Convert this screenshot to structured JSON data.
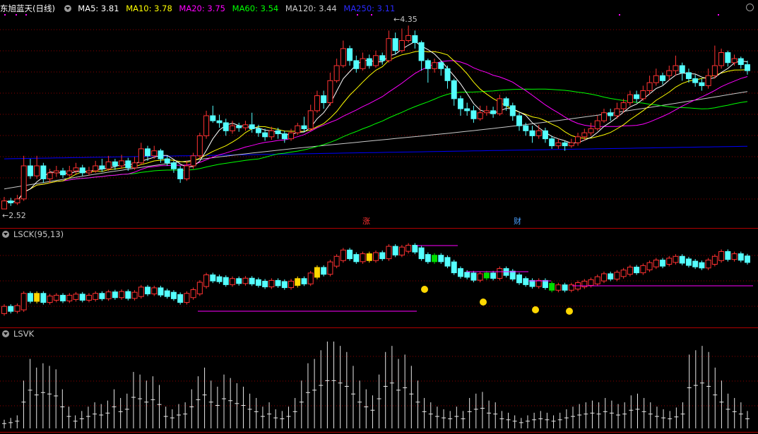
{
  "main_title": {
    "stock_name": "东旭蓝天",
    "period": "(日线)",
    "ma": [
      {
        "label": "MA5: 3.81",
        "color": "#ffffff"
      },
      {
        "label": "MA10: 3.78",
        "color": "#ffff00"
      },
      {
        "label": "MA20: 3.75",
        "color": "#ff00ff"
      },
      {
        "label": "MA60: 3.54",
        "color": "#00ff00"
      },
      {
        "label": "MA120: 3.44",
        "color": "#c8c8c8"
      },
      {
        "label": "MA250: 3.11",
        "color": "#0000ff"
      }
    ]
  },
  "annotations": {
    "high": "4.35",
    "low": "2.52",
    "event1": "涨",
    "event2": "财"
  },
  "sub1_title": "LSCK(95,13)",
  "sub2_title": "LSVK",
  "colors": {
    "up": "#ff3232",
    "down": "#54ffff",
    "ma5": "#ffffff",
    "ma10": "#ffff00",
    "ma20": "#ff00ff",
    "ma60": "#00ff00",
    "ma120": "#c8c8c8",
    "ma250": "#0000ff",
    "grid": "#8b0000",
    "border": "#b00000"
  },
  "chart_data": {
    "type": "candlestick",
    "price_range": [
      2.45,
      4.45
    ],
    "extremes": {
      "high": 4.35,
      "low": 2.52
    },
    "candles": [
      [
        2.52,
        2.6,
        2.64,
        2.52
      ],
      [
        2.6,
        2.58,
        2.63,
        2.55
      ],
      [
        2.58,
        2.62,
        2.66,
        2.56
      ],
      [
        2.62,
        2.95,
        3.05,
        2.6
      ],
      [
        2.95,
        2.85,
        3.02,
        2.82
      ],
      [
        2.85,
        2.95,
        3.05,
        2.82
      ],
      [
        2.95,
        2.82,
        2.98,
        2.78
      ],
      [
        2.82,
        2.88,
        2.92,
        2.78
      ],
      [
        2.88,
        2.9,
        2.95,
        2.84
      ],
      [
        2.9,
        2.86,
        2.93,
        2.83
      ],
      [
        2.86,
        2.9,
        2.95,
        2.84
      ],
      [
        2.9,
        2.93,
        2.98,
        2.87
      ],
      [
        2.93,
        2.88,
        2.96,
        2.85
      ],
      [
        2.88,
        2.9,
        2.94,
        2.85
      ],
      [
        2.9,
        2.95,
        3.0,
        2.88
      ],
      [
        2.95,
        2.92,
        3.02,
        2.89
      ],
      [
        2.92,
        2.99,
        3.05,
        2.9
      ],
      [
        2.99,
        2.95,
        3.02,
        2.91
      ],
      [
        2.95,
        3.0,
        3.06,
        2.92
      ],
      [
        3.0,
        2.93,
        3.03,
        2.9
      ],
      [
        2.93,
        2.98,
        3.04,
        2.91
      ],
      [
        2.98,
        3.12,
        3.18,
        2.96
      ],
      [
        3.12,
        3.05,
        3.15,
        3.0
      ],
      [
        3.05,
        3.1,
        3.15,
        3.02
      ],
      [
        3.1,
        3.02,
        3.12,
        2.98
      ],
      [
        3.02,
        2.98,
        3.05,
        2.95
      ],
      [
        2.98,
        2.92,
        3.0,
        2.88
      ],
      [
        2.92,
        2.82,
        2.95,
        2.78
      ],
      [
        2.82,
        2.95,
        3.0,
        2.8
      ],
      [
        2.95,
        3.05,
        3.08,
        2.92
      ],
      [
        3.05,
        3.25,
        3.28,
        3.02
      ],
      [
        3.25,
        3.45,
        3.5,
        3.22
      ],
      [
        3.45,
        3.4,
        3.55,
        3.38
      ],
      [
        3.4,
        3.38,
        3.46,
        3.33
      ],
      [
        3.38,
        3.3,
        3.42,
        3.25
      ],
      [
        3.3,
        3.35,
        3.4,
        3.27
      ],
      [
        3.35,
        3.33,
        3.38,
        3.29
      ],
      [
        3.33,
        3.36,
        3.4,
        3.3
      ],
      [
        3.36,
        3.32,
        3.48,
        3.28
      ],
      [
        3.32,
        3.28,
        3.36,
        3.24
      ],
      [
        3.28,
        3.24,
        3.32,
        3.2
      ],
      [
        3.24,
        3.3,
        3.34,
        3.21
      ],
      [
        3.3,
        3.27,
        3.33,
        3.22
      ],
      [
        3.27,
        3.22,
        3.3,
        3.18
      ],
      [
        3.22,
        3.28,
        3.32,
        3.2
      ],
      [
        3.28,
        3.35,
        3.38,
        3.26
      ],
      [
        3.35,
        3.32,
        3.44,
        3.29
      ],
      [
        3.32,
        3.5,
        3.56,
        3.3
      ],
      [
        3.5,
        3.65,
        3.7,
        3.48
      ],
      [
        3.65,
        3.58,
        3.7,
        3.52
      ],
      [
        3.58,
        3.8,
        3.88,
        3.55
      ],
      [
        3.8,
        3.95,
        4.02,
        3.78
      ],
      [
        3.95,
        4.12,
        4.2,
        3.93
      ],
      [
        4.12,
        4.0,
        4.15,
        3.95
      ],
      [
        4.0,
        3.92,
        4.05,
        3.88
      ],
      [
        3.92,
        4.02,
        4.08,
        3.9
      ],
      [
        4.02,
        3.95,
        4.06,
        3.92
      ],
      [
        3.95,
        4.05,
        4.1,
        3.93
      ],
      [
        4.05,
        4.0,
        4.08,
        3.96
      ],
      [
        4.0,
        4.22,
        4.3,
        3.98
      ],
      [
        4.22,
        4.1,
        4.28,
        4.06
      ],
      [
        4.1,
        4.2,
        4.32,
        4.08
      ],
      [
        4.2,
        4.25,
        4.35,
        4.18
      ],
      [
        4.25,
        4.18,
        4.3,
        4.12
      ],
      [
        4.18,
        4.0,
        4.2,
        3.9
      ],
      [
        4.0,
        3.92,
        4.02,
        3.78
      ],
      [
        3.92,
        3.98,
        4.02,
        3.88
      ],
      [
        3.98,
        3.92,
        4.0,
        3.85
      ],
      [
        3.92,
        3.8,
        3.95,
        3.72
      ],
      [
        3.8,
        3.62,
        3.82,
        3.55
      ],
      [
        3.62,
        3.52,
        3.65,
        3.45
      ],
      [
        3.52,
        3.5,
        3.58,
        3.45
      ],
      [
        3.5,
        3.42,
        3.55,
        3.38
      ],
      [
        3.42,
        3.48,
        3.55,
        3.4
      ],
      [
        3.48,
        3.5,
        3.55,
        3.45
      ],
      [
        3.5,
        3.47,
        3.54,
        3.43
      ],
      [
        3.47,
        3.62,
        3.66,
        3.45
      ],
      [
        3.62,
        3.55,
        3.64,
        3.5
      ],
      [
        3.55,
        3.45,
        3.58,
        3.4
      ],
      [
        3.45,
        3.35,
        3.48,
        3.3
      ],
      [
        3.35,
        3.3,
        3.38,
        3.25
      ],
      [
        3.3,
        3.25,
        3.35,
        3.18
      ],
      [
        3.25,
        3.3,
        3.36,
        3.22
      ],
      [
        3.3,
        3.22,
        3.33,
        3.18
      ],
      [
        3.22,
        3.15,
        3.25,
        3.12
      ],
      [
        3.15,
        3.18,
        3.22,
        3.12
      ],
      [
        3.18,
        3.15,
        3.2,
        3.1
      ],
      [
        3.15,
        3.18,
        3.22,
        3.13
      ],
      [
        3.18,
        3.24,
        3.28,
        3.15
      ],
      [
        3.24,
        3.28,
        3.32,
        3.2
      ],
      [
        3.28,
        3.32,
        3.38,
        3.25
      ],
      [
        3.32,
        3.4,
        3.45,
        3.3
      ],
      [
        3.4,
        3.48,
        3.52,
        3.38
      ],
      [
        3.48,
        3.45,
        3.52,
        3.4
      ],
      [
        3.45,
        3.52,
        3.58,
        3.42
      ],
      [
        3.52,
        3.58,
        3.62,
        3.48
      ],
      [
        3.58,
        3.66,
        3.7,
        3.55
      ],
      [
        3.66,
        3.62,
        3.7,
        3.58
      ],
      [
        3.62,
        3.7,
        3.75,
        3.6
      ],
      [
        3.7,
        3.78,
        3.85,
        3.66
      ],
      [
        3.78,
        3.85,
        3.92,
        3.75
      ],
      [
        3.85,
        3.8,
        3.88,
        3.76
      ],
      [
        3.85,
        3.9,
        3.95,
        3.8
      ],
      [
        3.9,
        3.95,
        4.05,
        3.85
      ],
      [
        3.95,
        3.88,
        3.98,
        3.8
      ],
      [
        3.88,
        3.82,
        3.92,
        3.78
      ],
      [
        3.82,
        3.78,
        3.86,
        3.74
      ],
      [
        3.78,
        3.75,
        3.82,
        3.7
      ],
      [
        3.75,
        3.85,
        3.92,
        3.72
      ],
      [
        3.85,
        3.95,
        4.15,
        3.82
      ],
      [
        3.95,
        4.08,
        4.12,
        3.92
      ],
      [
        4.08,
        3.98,
        4.1,
        3.94
      ],
      [
        3.98,
        4.02,
        4.06,
        3.95
      ],
      [
        4.02,
        3.96,
        4.04,
        3.92
      ],
      [
        3.96,
        3.9,
        4.0,
        3.86
      ]
    ],
    "moving_averages": {
      "MA5": "white",
      "MA10": "yellow",
      "MA20": "magenta",
      "MA60": "green",
      "MA120": "light gray",
      "MA250": "blue"
    },
    "lsck_dots": [
      0.5,
      0.58,
      0.68,
      0.72
    ],
    "lsvk_values": [
      0.1,
      0.12,
      0.15,
      0.55,
      0.8,
      0.7,
      0.75,
      0.72,
      0.68,
      0.45,
      0.25,
      0.15,
      0.2,
      0.25,
      0.3,
      0.28,
      0.32,
      0.45,
      0.35,
      0.4,
      0.65,
      0.62,
      0.55,
      0.6,
      0.5,
      0.25,
      0.22,
      0.28,
      0.3,
      0.45,
      0.6,
      0.7,
      0.55,
      0.48,
      0.62,
      0.58,
      0.52,
      0.48,
      0.4,
      0.35,
      0.25,
      0.3,
      0.22,
      0.2,
      0.25,
      0.35,
      0.55,
      0.75,
      0.8,
      0.9,
      1.0,
      1.0,
      0.95,
      0.88,
      0.72,
      0.55,
      0.45,
      0.38,
      0.62,
      0.88,
      0.95,
      0.8,
      0.85,
      0.72,
      0.55,
      0.35,
      0.3,
      0.25,
      0.22,
      0.2,
      0.25,
      0.2,
      0.35,
      0.4,
      0.42,
      0.32,
      0.3,
      0.2,
      0.18,
      0.15,
      0.12,
      0.15,
      0.18,
      0.2,
      0.18,
      0.15,
      0.18,
      0.22,
      0.25,
      0.28,
      0.3,
      0.32,
      0.3,
      0.35,
      0.32,
      0.28,
      0.3,
      0.38,
      0.4,
      0.35,
      0.3,
      0.25,
      0.22,
      0.2,
      0.24,
      0.3,
      0.85,
      0.9,
      0.95,
      0.88,
      0.7,
      0.55,
      0.4,
      0.35,
      0.3,
      0.2
    ]
  }
}
